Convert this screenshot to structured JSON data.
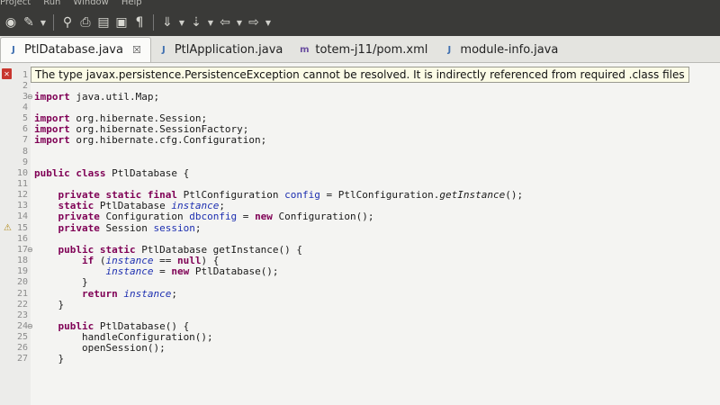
{
  "menu": {
    "items": [
      "Project",
      "Run",
      "Window",
      "Help"
    ]
  },
  "toolbar": {
    "icons": [
      "run-icon",
      "debug-icon",
      "dropdown-icon",
      "search-icon",
      "open-type-icon",
      "open-task-icon",
      "toggle-mark-icon",
      "show-whitespace-icon",
      "annotation-icon",
      "annotation-dropdown-icon",
      "next-annotation-icon",
      "prev-annotation-icon",
      "back-icon",
      "back-dropdown-icon",
      "forward-icon",
      "forward-dropdown-icon"
    ]
  },
  "tabs": [
    {
      "label": "PtlDatabase.java",
      "icon": "java-file-icon",
      "active": true,
      "close": "☒"
    },
    {
      "label": "PtlApplication.java",
      "icon": "java-file-icon",
      "active": false
    },
    {
      "label": "totem-j11/pom.xml",
      "icon": "xml-file-icon",
      "active": false
    },
    {
      "label": "module-info.java",
      "icon": "java-file-icon",
      "active": false
    }
  ],
  "tooltip": {
    "text": "The type javax.persistence.PersistenceException cannot be resolved. It is indirectly referenced from required .class files"
  },
  "editor": {
    "lines": [
      {
        "n": "1",
        "mark": "error"
      },
      {
        "n": "2"
      },
      {
        "n": "3",
        "fold": "⊖",
        "parts": [
          [
            "kw",
            "import"
          ],
          [
            "",
            " java.util.Map;"
          ]
        ]
      },
      {
        "n": "4"
      },
      {
        "n": "5",
        "parts": [
          [
            "kw",
            "import"
          ],
          [
            "",
            " org.hibernate.Session;"
          ]
        ]
      },
      {
        "n": "6",
        "parts": [
          [
            "kw",
            "import"
          ],
          [
            "",
            " org.hibernate.SessionFactory;"
          ]
        ]
      },
      {
        "n": "7",
        "parts": [
          [
            "kw",
            "import"
          ],
          [
            "",
            " org.hibernate.cfg.Configuration;"
          ]
        ]
      },
      {
        "n": "8"
      },
      {
        "n": "9"
      },
      {
        "n": "10",
        "parts": [
          [
            "kw",
            "public class"
          ],
          [
            "",
            " PtlDatabase {"
          ]
        ]
      },
      {
        "n": "11"
      },
      {
        "n": "12",
        "parts": [
          [
            "",
            "    "
          ],
          [
            "kw",
            "private static final"
          ],
          [
            "",
            " PtlConfiguration "
          ],
          [
            "fld",
            "config"
          ],
          [
            "",
            " = PtlConfiguration."
          ],
          [
            "it",
            "getInstance"
          ],
          [
            "",
            "();"
          ]
        ]
      },
      {
        "n": "13",
        "parts": [
          [
            "",
            "    "
          ],
          [
            "kw",
            "static"
          ],
          [
            "",
            " PtlDatabase "
          ],
          [
            "fld it",
            "instance"
          ],
          [
            "",
            ";"
          ]
        ]
      },
      {
        "n": "14",
        "parts": [
          [
            "",
            "    "
          ],
          [
            "kw",
            "private"
          ],
          [
            "",
            " Configuration "
          ],
          [
            "fld",
            "dbconfig"
          ],
          [
            "",
            " = "
          ],
          [
            "kw",
            "new"
          ],
          [
            "",
            " Configuration();"
          ]
        ]
      },
      {
        "n": "15",
        "mark": "warning",
        "parts": [
          [
            "",
            "    "
          ],
          [
            "kw",
            "private"
          ],
          [
            "",
            " Session "
          ],
          [
            "fld",
            "session"
          ],
          [
            "",
            ";"
          ]
        ]
      },
      {
        "n": "16"
      },
      {
        "n": "17",
        "fold": "⊖",
        "parts": [
          [
            "",
            "    "
          ],
          [
            "kw",
            "public static"
          ],
          [
            "",
            " PtlDatabase getInstance() {"
          ]
        ]
      },
      {
        "n": "18",
        "parts": [
          [
            "",
            "        "
          ],
          [
            "kw",
            "if"
          ],
          [
            "",
            " ("
          ],
          [
            "fld it",
            "instance"
          ],
          [
            "",
            " == "
          ],
          [
            "kw",
            "null"
          ],
          [
            "",
            ") {"
          ]
        ]
      },
      {
        "n": "19",
        "parts": [
          [
            "",
            "            "
          ],
          [
            "fld it",
            "instance"
          ],
          [
            "",
            " = "
          ],
          [
            "kw",
            "new"
          ],
          [
            "",
            " PtlDatabase();"
          ]
        ]
      },
      {
        "n": "20",
        "parts": [
          [
            "",
            "        }"
          ]
        ]
      },
      {
        "n": "21",
        "parts": [
          [
            "",
            "        "
          ],
          [
            "kw",
            "return"
          ],
          [
            "",
            " "
          ],
          [
            "fld it",
            "instance"
          ],
          [
            "",
            ";"
          ]
        ]
      },
      {
        "n": "22",
        "parts": [
          [
            "",
            "    }"
          ]
        ]
      },
      {
        "n": "23"
      },
      {
        "n": "24",
        "fold": "⊖",
        "parts": [
          [
            "",
            "    "
          ],
          [
            "kw",
            "public"
          ],
          [
            "",
            " PtlDatabase() {"
          ]
        ]
      },
      {
        "n": "25",
        "parts": [
          [
            "",
            "        handleConfiguration();"
          ]
        ]
      },
      {
        "n": "26",
        "parts": [
          [
            "",
            "        openSession();"
          ]
        ]
      },
      {
        "n": "27",
        "parts": [
          [
            "",
            "    }"
          ]
        ]
      }
    ]
  }
}
